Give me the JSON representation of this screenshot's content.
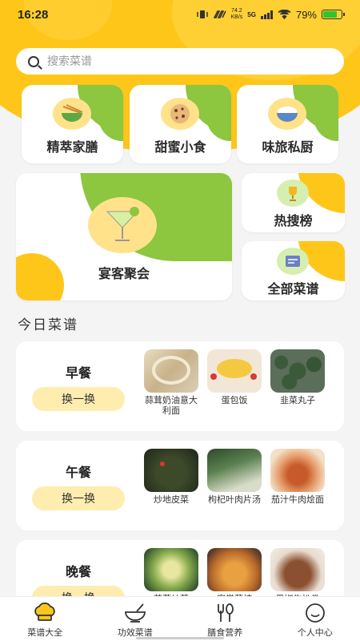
{
  "status": {
    "time": "16:28",
    "net_speed": "74.2",
    "net_unit": "KB/s",
    "network": "5G",
    "battery": "79%",
    "battery_level": 0.79
  },
  "search": {
    "placeholder": "搜索菜谱"
  },
  "categories": [
    {
      "label": "精萃家膳",
      "icon": "bowl-chopsticks-icon"
    },
    {
      "label": "甜蜜小食",
      "icon": "cookie-icon"
    },
    {
      "label": "味旅私厨",
      "icon": "rice-bowl-icon"
    }
  ],
  "feature": {
    "label": "宴客聚会",
    "icon": "cocktail-icon"
  },
  "hot": {
    "label": "热搜榜",
    "icon": "trophy-icon"
  },
  "all": {
    "label": "全部菜谱",
    "icon": "menu-board-icon"
  },
  "today_title": "今日菜谱",
  "meals": [
    {
      "name": "早餐",
      "swap": "换一换",
      "dishes": [
        "蒜茸奶油意大利面",
        "蛋包饭",
        "韭菜丸子"
      ]
    },
    {
      "name": "午餐",
      "swap": "换一换",
      "dishes": [
        "炒地皮菜",
        "枸杞叶肉片汤",
        "茄汁牛肉烩面"
      ]
    },
    {
      "name": "晚餐",
      "swap": "换一换",
      "dishes": [
        "蒜蓉炒菜",
        "家常菜炖",
        "黑椒牛扒卷"
      ]
    }
  ],
  "tabs": [
    {
      "label": "菜谱大全",
      "icon": "chef-hat-icon",
      "active": true
    },
    {
      "label": "功效菜谱",
      "icon": "mortar-bowl-icon",
      "active": false
    },
    {
      "label": "膳食营养",
      "icon": "fork-spoon-icon",
      "active": false
    },
    {
      "label": "个人中心",
      "icon": "smile-face-icon",
      "active": false
    }
  ],
  "colors": {
    "accent": "#ffc61a",
    "green": "#8dc63f",
    "swap_bg": "#ffedb0",
    "icon_circle": "#ffe28a"
  }
}
